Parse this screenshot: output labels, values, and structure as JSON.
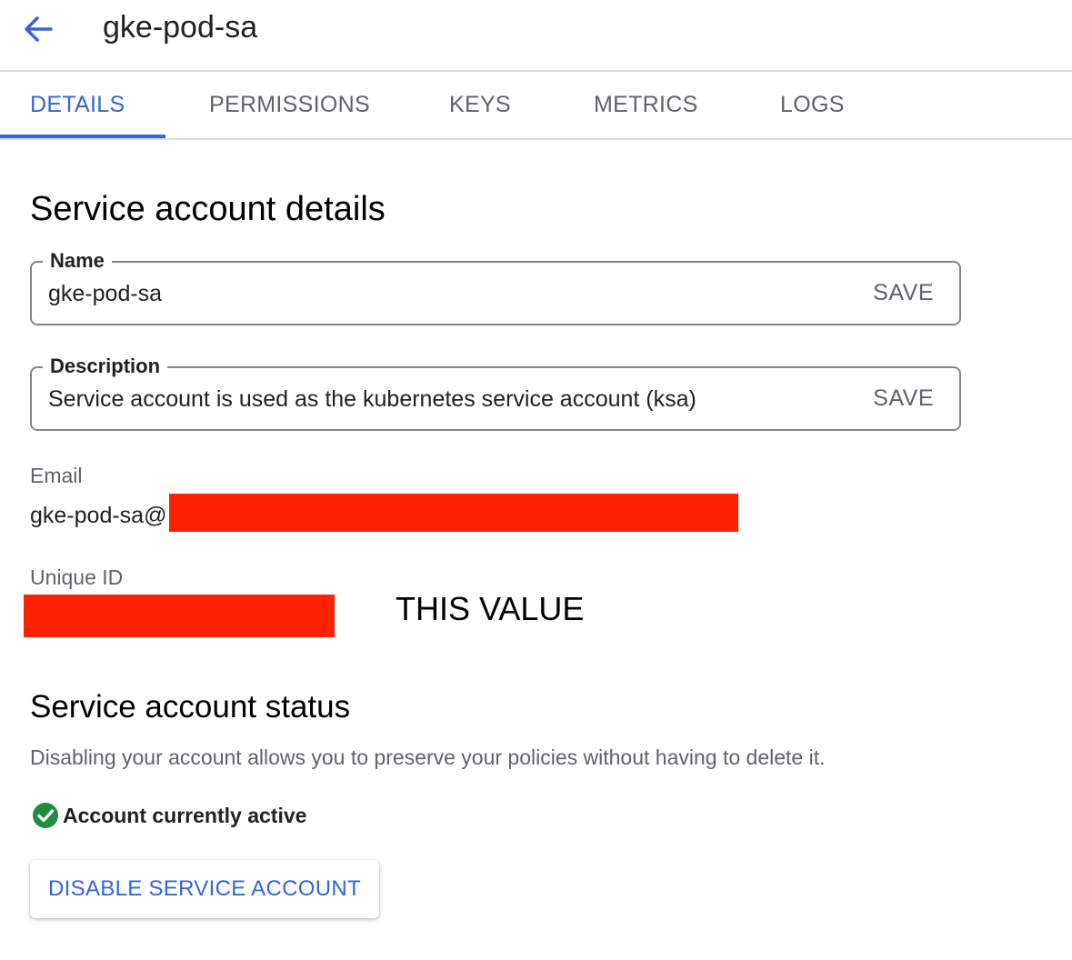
{
  "header": {
    "title": "gke-pod-sa",
    "back_icon": "arrow-back-icon"
  },
  "tabs": [
    {
      "label": "DETAILS",
      "active": true
    },
    {
      "label": "PERMISSIONS",
      "active": false
    },
    {
      "label": "KEYS",
      "active": false
    },
    {
      "label": "METRICS",
      "active": false
    },
    {
      "label": "LOGS",
      "active": false
    }
  ],
  "details": {
    "title": "Service account details",
    "name_field": {
      "label": "Name",
      "value": "gke-pod-sa",
      "save_label": "SAVE"
    },
    "description_field": {
      "label": "Description",
      "value": "Service account is used as the kubernetes service account (ksa)",
      "save_label": "SAVE"
    },
    "email": {
      "label": "Email",
      "value_visible": "gke-pod-sa@"
    },
    "unique_id": {
      "label": "Unique ID",
      "annotation": "THIS VALUE"
    }
  },
  "status": {
    "title": "Service account status",
    "description": "Disabling your account allows you to preserve your policies without having to delete it.",
    "state_text": "Account currently active",
    "state_icon": "check-circle-icon",
    "disable_label": "DISABLE SERVICE ACCOUNT"
  },
  "colors": {
    "accent": "#3367d6",
    "active_green": "#1e8e3e",
    "redaction": "#ff2200"
  }
}
